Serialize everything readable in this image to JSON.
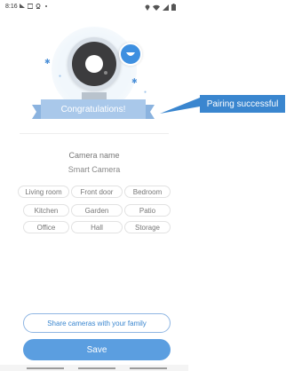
{
  "status_bar": {
    "time": "8:16",
    "left_icons": [
      "cast-icon",
      "image-icon",
      "location-icon",
      "dot-icon"
    ],
    "right_icons": [
      "location-pin-icon",
      "wifi-icon",
      "signal-icon",
      "battery-icon"
    ]
  },
  "hero": {
    "banner_text": "Congratulations!",
    "badge_icon": "smile-icon"
  },
  "callout": {
    "text": "Pairing successful"
  },
  "camera": {
    "label": "Camera name",
    "value": "Smart Camera"
  },
  "rooms": [
    "Living room",
    "Front door",
    "Bedroom",
    "Kitchen",
    "Garden",
    "Patio",
    "Office",
    "Hall",
    "Storage"
  ],
  "actions": {
    "share_label": "Share cameras with your family",
    "save_label": "Save"
  },
  "colors": {
    "accent": "#3a86cf",
    "save_button": "#5b9ee0",
    "banner": "#a9c8ea"
  }
}
